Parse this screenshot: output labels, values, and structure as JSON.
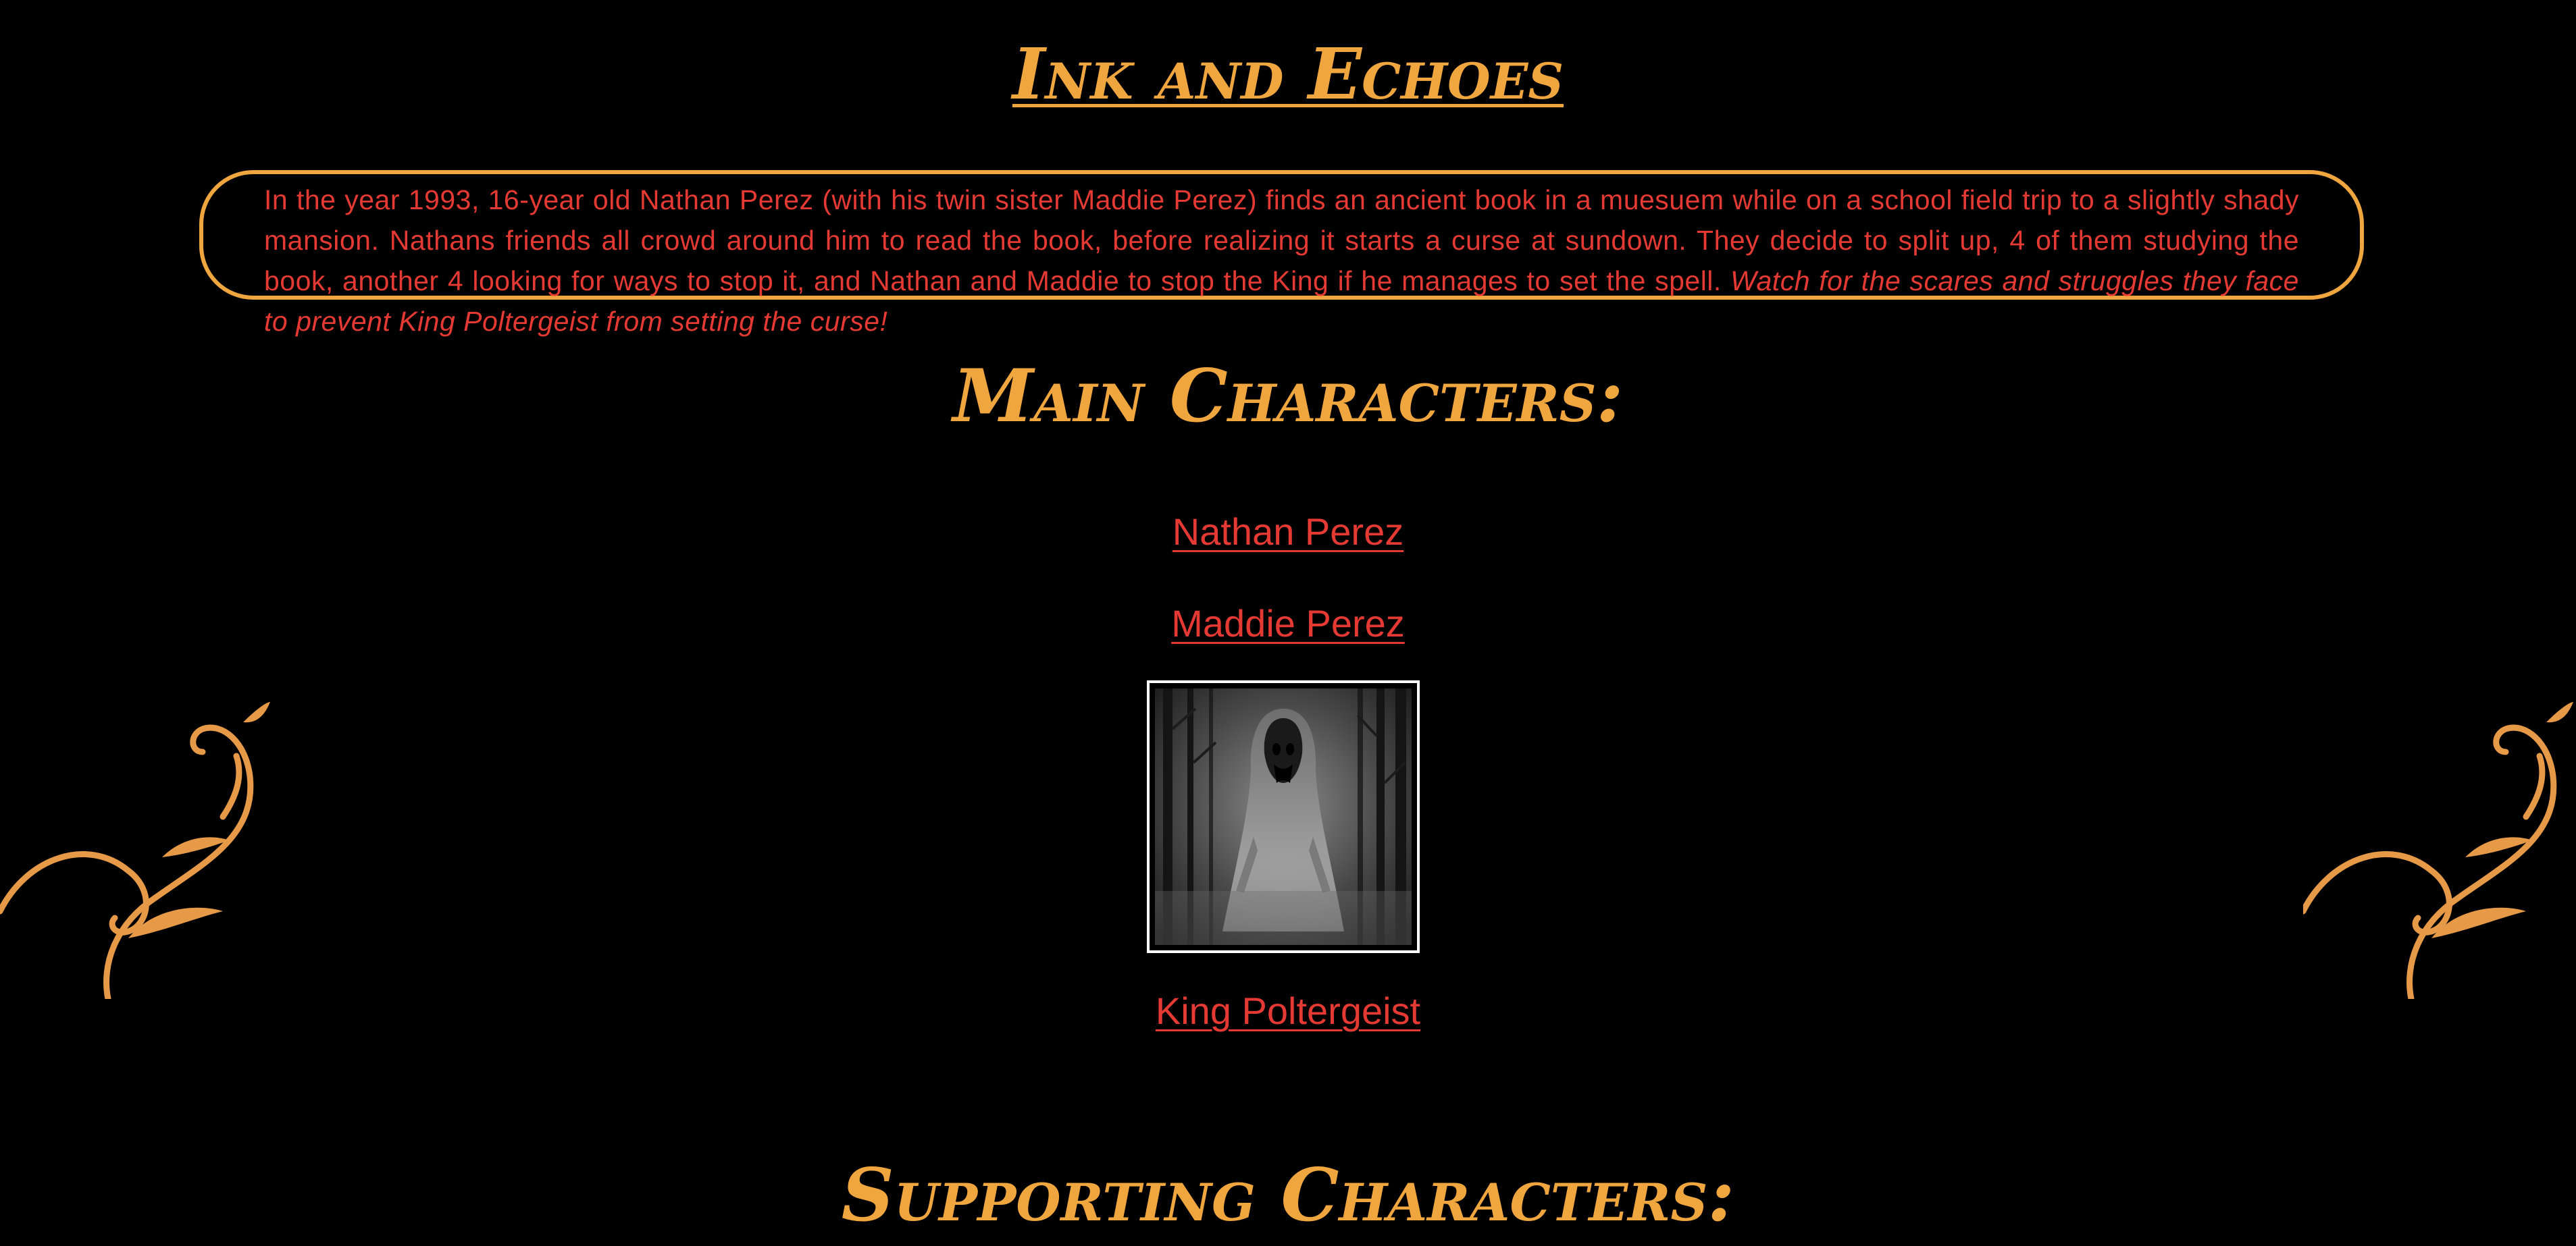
{
  "page": {
    "title": "Ink and Echoes",
    "summary": {
      "main": "In the year 1993, 16-year old Nathan Perez (with his twin sister Maddie Perez) finds an ancient book in a muesuem while on a school field trip to a slightly shady mansion. Nathans friends all crowd around him to read the book, before realizing it starts a curse at sundown. They decide to split up, 4 of them studying the book, another 4 looking for ways to stop it, and Nathan and Maddie to stop the King if he manages to set the spell.",
      "emphasis": "Watch for the scares and struggles they face to prevent King Poltergeist from setting the curse!"
    },
    "main_characters_heading": "Main Characters:",
    "supporting_characters_heading": "Supporting Characters:",
    "characters": {
      "nathan": "Nathan Perez",
      "maddie": "Maddie Perez",
      "king": "King Poltergeist"
    },
    "colors": {
      "background": "#000000",
      "accent_orange": "#f0a63e",
      "link_red": "#e53a33",
      "frame_white": "#ffffff"
    },
    "icons": {
      "left_ornament": "flourish-ornament",
      "right_ornament": "flourish-ornament",
      "portrait": "hooded-ghost-in-forest"
    }
  }
}
